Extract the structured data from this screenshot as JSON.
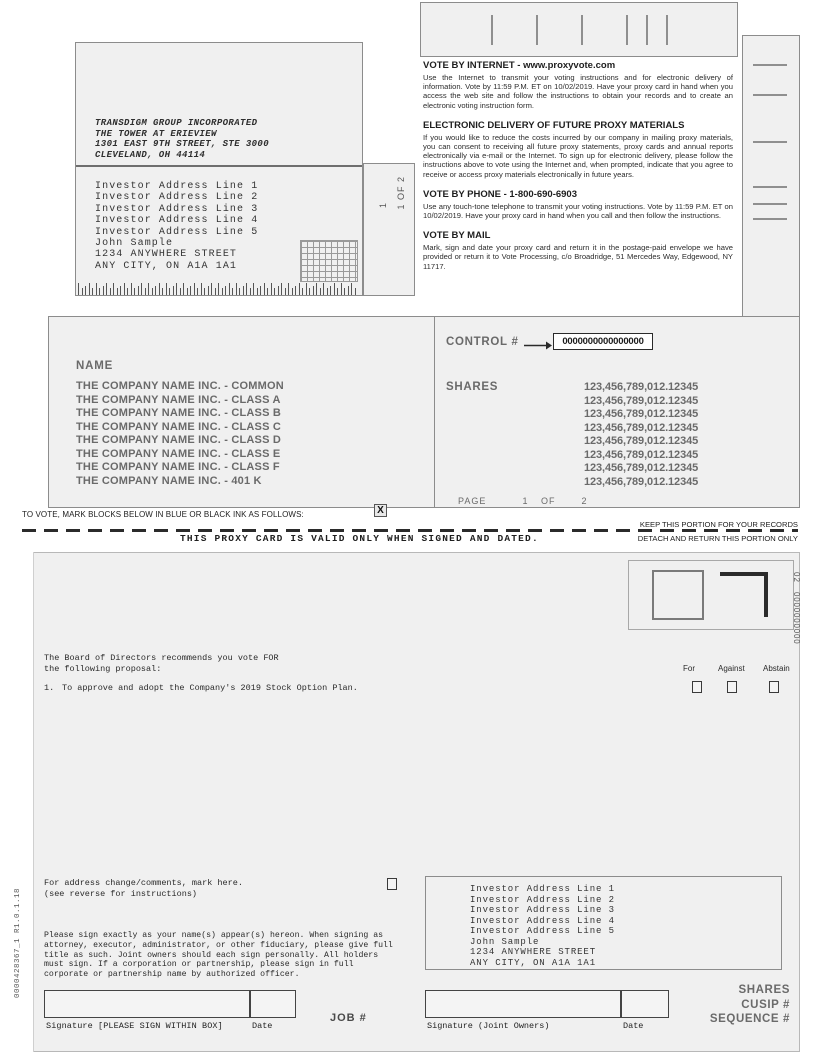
{
  "top_barcode": {
    "name": "postal-barcode"
  },
  "mail_panel": {
    "company": [
      "TRANSDIGM GROUP INCORPORATED",
      "THE TOWER AT ERIEVIEW",
      "1301 EAST 9TH STREET, STE 3000",
      "CLEVELAND, OH 44114"
    ],
    "investor": [
      "Investor Address Line 1",
      "Investor Address Line 2",
      "Investor Address Line 3",
      "Investor Address Line 4",
      "Investor Address Line 5",
      "John Sample",
      "1234 ANYWHERE STREET",
      "ANY CITY, ON  A1A 1A1"
    ]
  },
  "page_of_panel": {
    "one": "1",
    "of_two": "1 OF 2"
  },
  "instructions": [
    {
      "heading": "VOTE BY INTERNET - www.proxyvote.com",
      "body": "Use the Internet to transmit your voting instructions and for electronic delivery of information. Vote by 11:59 P.M. ET on 10/02/2019. Have your proxy card in hand when you access the web site and follow the instructions to obtain your records and to create an electronic voting instruction form."
    },
    {
      "heading": "ELECTRONIC DELIVERY OF FUTURE PROXY MATERIALS",
      "body": "If you would like to reduce the costs incurred by our company in mailing proxy materials, you can consent to receiving all future proxy statements, proxy cards and annual reports electronically via e-mail or the Internet. To sign up for electronic delivery, please follow the instructions above to vote using the Internet and, when prompted, indicate that you agree to receive or access proxy materials electronically in future years."
    },
    {
      "heading": "VOTE BY PHONE - 1-800-690-6903",
      "body": "Use any touch-tone telephone to transmit your voting instructions. Vote by 11:59 P.M. ET on 10/02/2019. Have your proxy card in hand when you call and then follow the instructions."
    },
    {
      "heading": "VOTE BY MAIL",
      "body": "Mark, sign and date your proxy card and return it in the postage-paid envelope we have provided or return it to Vote Processing, c/o Broadridge, 51 Mercedes Way, Edgewood, NY 11717."
    }
  ],
  "name_panel": {
    "header": "NAME",
    "rows": [
      "THE COMPANY NAME INC. - COMMON",
      "THE COMPANY NAME INC. - CLASS A",
      "THE COMPANY NAME INC. - CLASS B",
      "THE COMPANY NAME INC. - CLASS C",
      "THE COMPANY NAME INC. - CLASS D",
      "THE COMPANY NAME INC. - CLASS E",
      "THE COMPANY NAME INC. - CLASS F",
      "THE COMPANY NAME INC. - 401 K"
    ]
  },
  "control_panel": {
    "control_label": "CONTROL #",
    "control_number": "0000000000000000",
    "shares_label": "SHARES",
    "shares_values": [
      "123,456,789,012.12345",
      "123,456,789,012.12345",
      "123,456,789,012.12345",
      "123,456,789,012.12345",
      "123,456,789,012.12345",
      "123,456,789,012.12345",
      "123,456,789,012.12345",
      "123,456,789,012.12345"
    ],
    "page_label": "PAGE",
    "page_current": "1",
    "page_of": "OF",
    "page_total": "2"
  },
  "mid": {
    "vote_mark_text": "TO VOTE, MARK BLOCKS BELOW IN BLUE OR BLACK INK AS FOLLOWS:",
    "x_mark": "X",
    "keep_portion": "KEEP THIS PORTION FOR YOUR RECORDS",
    "detach_portion": "DETACH AND RETURN THIS PORTION ONLY",
    "proxy_valid": "THIS PROXY CARD IS VALID ONLY WHEN SIGNED AND DATED."
  },
  "lower_card": {
    "form_id": "0000428367_1   R1.0.1.18",
    "right_marker_02": "02",
    "right_marker_num": "0000000000",
    "recommend_line1": "The Board of Directors recommends you vote FOR",
    "recommend_line2": "the following proposal:",
    "proposal_number": "1.",
    "proposal_text": "To approve and adopt the Company's 2019 Stock Option Plan.",
    "vote_headers": [
      "For",
      "Against",
      "Abstain"
    ],
    "address_change_line1": "For address change/comments, mark here.",
    "address_change_line2": "(see reverse for instructions)",
    "signature_note": "Please sign exactly as your name(s) appear(s) hereon. When signing as attorney, executor, administrator, or other fiduciary, please give full title as such. Joint owners should each sign personally. All holders must sign. If a corporation or partnership, please sign in full corporate or partnership name by authorized officer.",
    "investor": [
      "Investor Address Line 1",
      "Investor Address Line 2",
      "Investor Address Line 3",
      "Investor Address Line 4",
      "Investor Address Line 5",
      "John Sample",
      "1234 ANYWHERE STREET",
      "ANY CITY, ON  A1A 1A1"
    ],
    "signature1_label": "Signature [PLEASE SIGN WITHIN BOX]",
    "date1_label": "Date",
    "job_label": "JOB #",
    "signature2_label": "Signature (Joint Owners)",
    "date2_label": "Date",
    "tail_labels": [
      "SHARES",
      "CUSIP #",
      "SEQUENCE #"
    ]
  }
}
